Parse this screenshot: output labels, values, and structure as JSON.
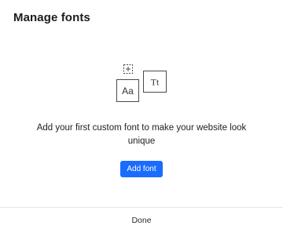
{
  "dialog": {
    "title": "Manage fonts"
  },
  "illustration": {
    "icons": [
      "add-font-icon",
      "font-sample-icon",
      "font-sample-serif-icon"
    ],
    "sample_sans": "Aa",
    "sample_serif": "Tt"
  },
  "empty_state": {
    "message": "Add your first custom font to make your website look unique"
  },
  "actions": {
    "add_font_label": "Add font",
    "done_label": "Done"
  },
  "colors": {
    "primary_button": "#1a6cff",
    "divider": "#e6e6e6"
  }
}
